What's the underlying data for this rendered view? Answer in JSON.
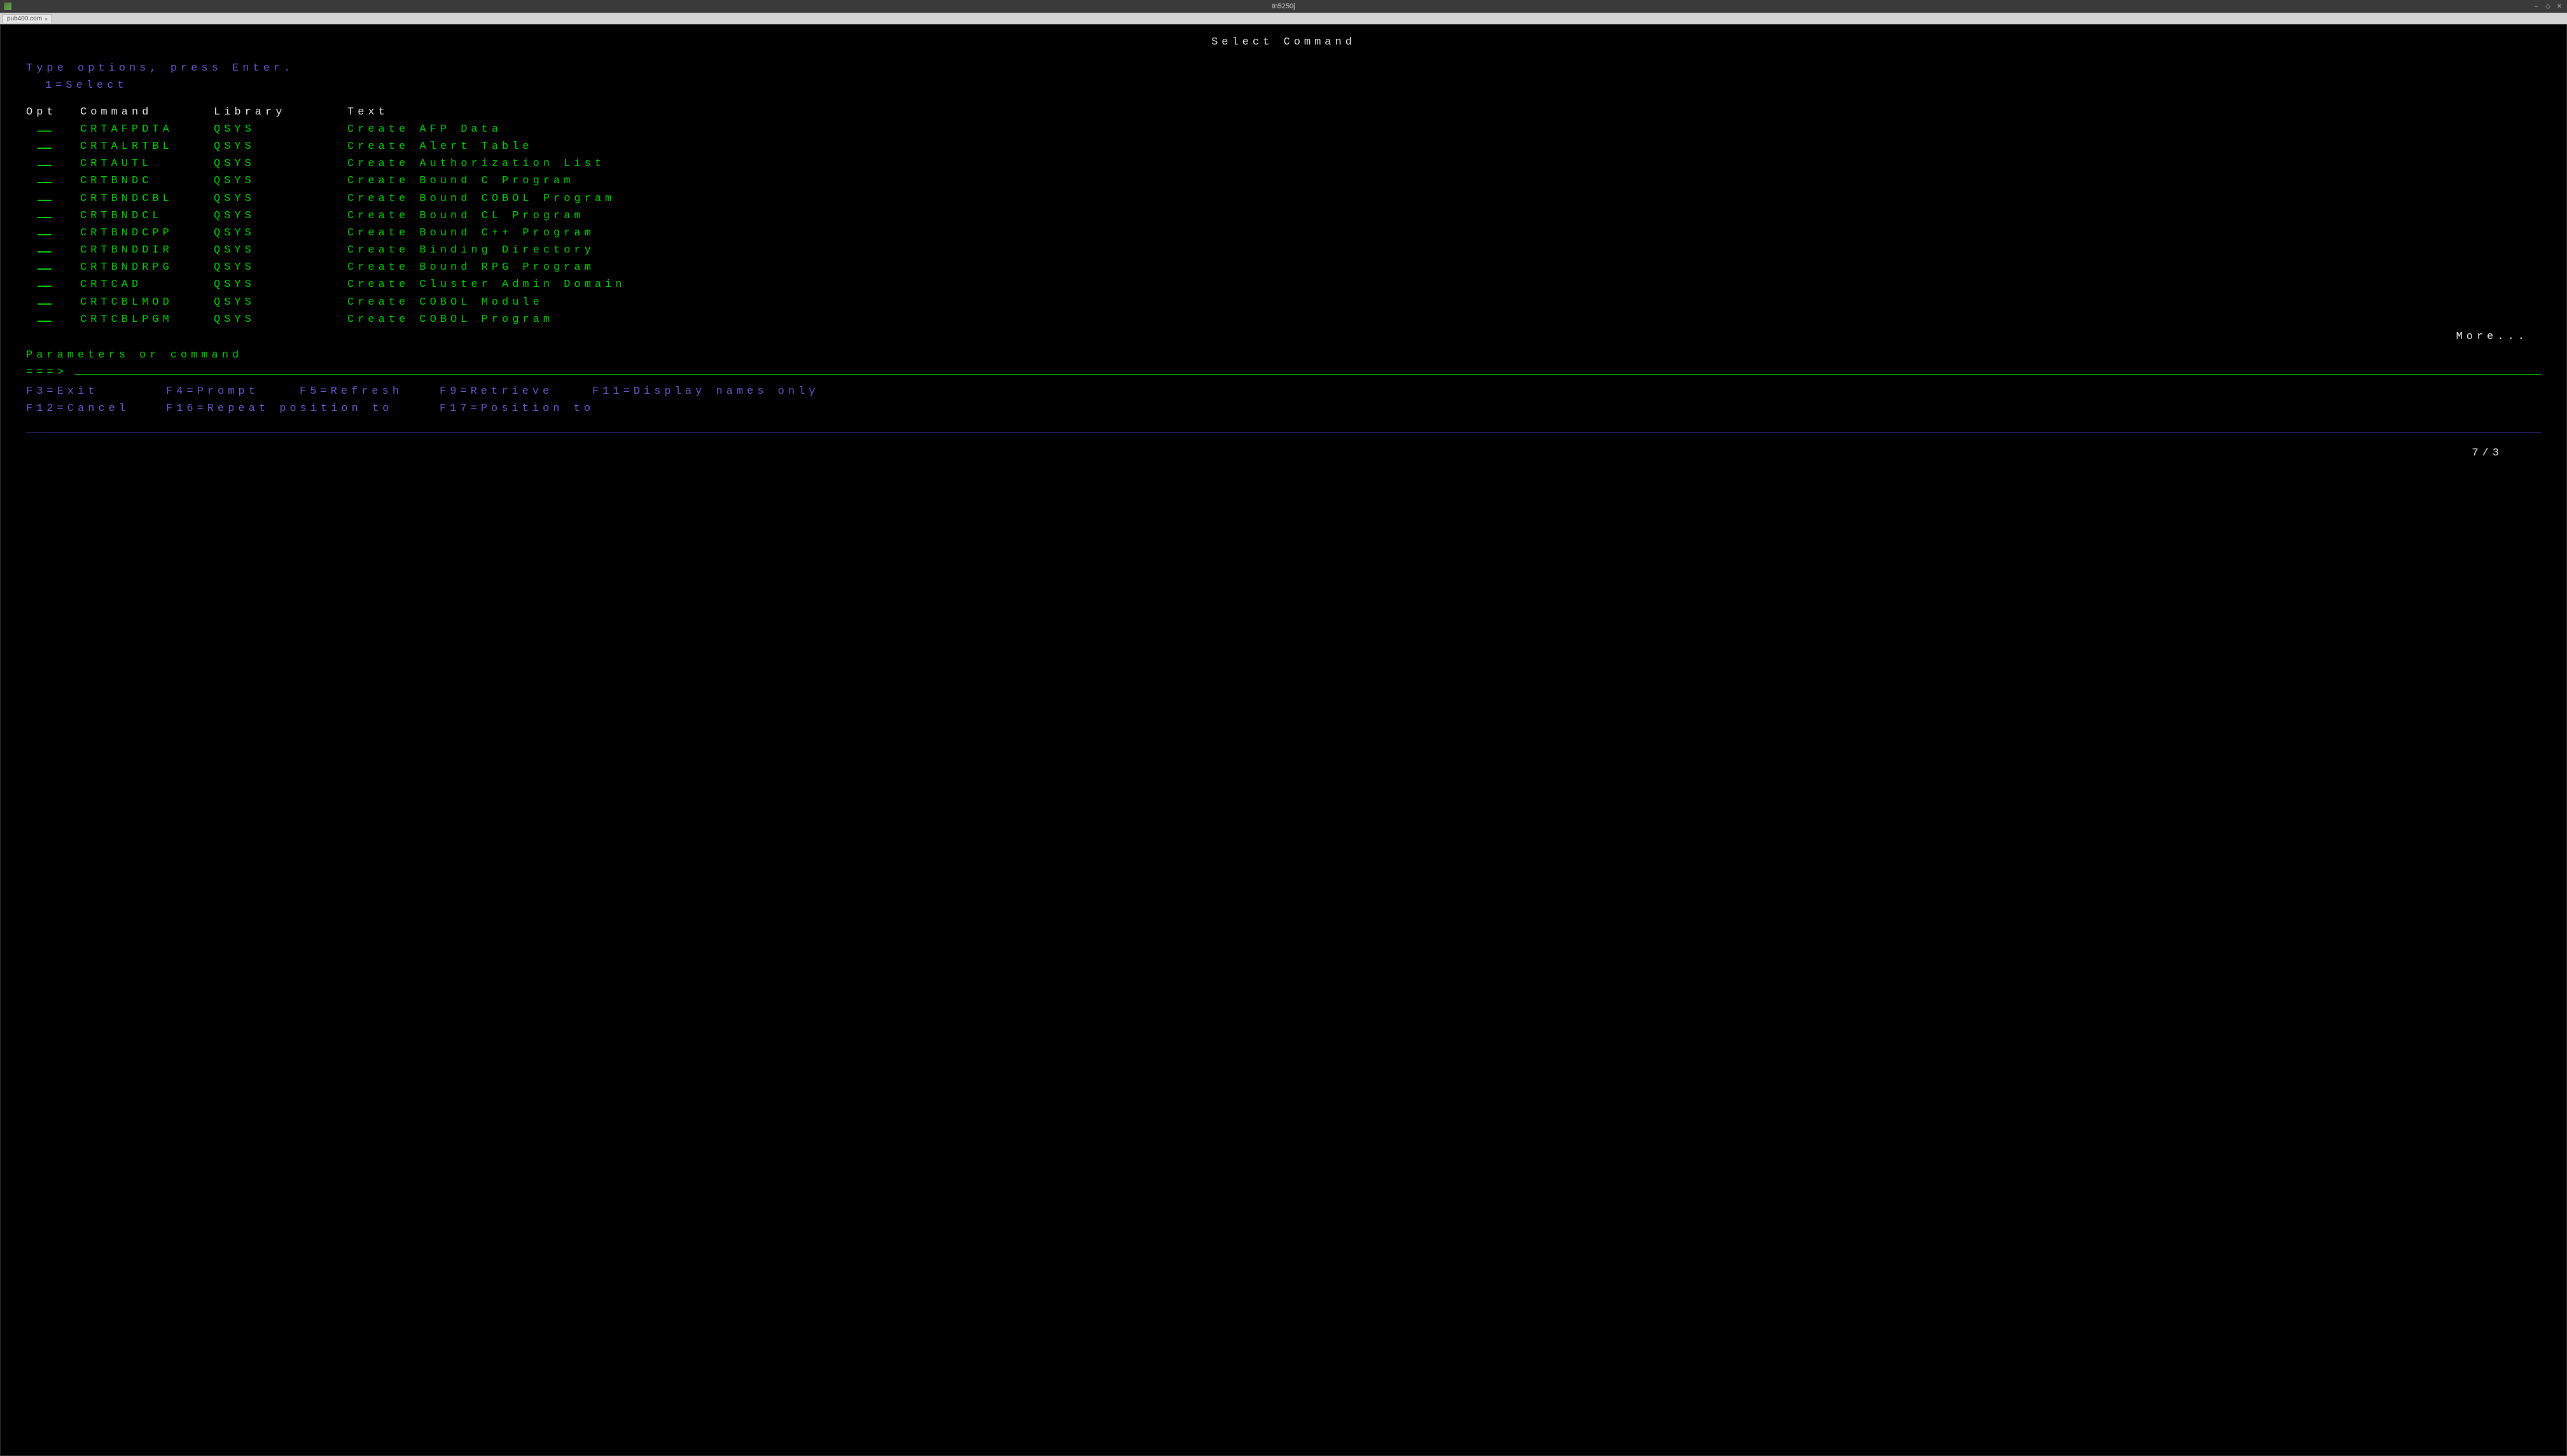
{
  "window": {
    "title": "tn5250j"
  },
  "tab": {
    "label": "pub400.com",
    "close": "×"
  },
  "screen": {
    "title": "Select Command",
    "instructions_line1": "Type options, press Enter.",
    "instructions_line2": "1=Select",
    "headers": {
      "opt": "Opt",
      "command": "Command",
      "library": "Library",
      "text": "Text"
    },
    "rows": [
      {
        "command": "CRTAFPDTA",
        "library": "QSYS",
        "text": "Create AFP Data"
      },
      {
        "command": "CRTALRTBL",
        "library": "QSYS",
        "text": "Create Alert Table"
      },
      {
        "command": "CRTAUTL",
        "library": "QSYS",
        "text": "Create Authorization List"
      },
      {
        "command": "CRTBNDC",
        "library": "QSYS",
        "text": "Create Bound C Program"
      },
      {
        "command": "CRTBNDCBL",
        "library": "QSYS",
        "text": "Create Bound COBOL Program"
      },
      {
        "command": "CRTBNDCL",
        "library": "QSYS",
        "text": "Create Bound CL Program"
      },
      {
        "command": "CRTBNDCPP",
        "library": "QSYS",
        "text": "Create Bound C++ Program"
      },
      {
        "command": "CRTBNDDIR",
        "library": "QSYS",
        "text": "Create Binding Directory"
      },
      {
        "command": "CRTBNDRPG",
        "library": "QSYS",
        "text": "Create Bound RPG Program"
      },
      {
        "command": "CRTCAD",
        "library": "QSYS",
        "text": "Create Cluster Admin Domain"
      },
      {
        "command": "CRTCBLMOD",
        "library": "QSYS",
        "text": "Create COBOL Module"
      },
      {
        "command": "CRTCBLPGM",
        "library": "QSYS",
        "text": "Create COBOL Program"
      }
    ],
    "more": "More...",
    "param_label": "Parameters or command",
    "cmd_prompt": "===>",
    "fkeys_line1": [
      "F3=Exit",
      "F4=Prompt",
      "F5=Refresh",
      "F9=Retrieve",
      "F11=Display names only"
    ],
    "fkeys_line2": [
      "F12=Cancel",
      "F16=Repeat position to",
      "F17=Position to"
    ],
    "status": "7/3"
  }
}
